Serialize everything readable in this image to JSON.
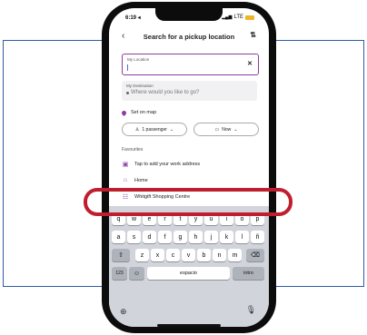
{
  "status_bar": {
    "time": "6:19 ◂",
    "network": "LTE"
  },
  "header": {
    "back_icon": "chevron-left",
    "title": "Search for a pickup location",
    "swap_icon": "swap-arrows"
  },
  "pickup": {
    "label": "My Location",
    "clear_icon": "close"
  },
  "destination": {
    "label": "My Destination",
    "placeholder": "Where would you like to go?"
  },
  "set_on_map": "Set on map",
  "passenger_pill": "1 passenger",
  "time_pill": "Now",
  "favourites": {
    "title": "Favourites",
    "items": [
      {
        "icon": "briefcase",
        "label": "Tap to add your work address"
      },
      {
        "icon": "home",
        "label": "Home"
      },
      {
        "icon": "saved-place",
        "label": "Whitgift Shopping Centre"
      }
    ]
  },
  "keyboard": {
    "row1": [
      "q",
      "w",
      "e",
      "r",
      "t",
      "y",
      "u",
      "i",
      "o",
      "p"
    ],
    "row2": [
      "a",
      "s",
      "d",
      "f",
      "g",
      "h",
      "j",
      "k",
      "l",
      "ñ"
    ],
    "row3": [
      "z",
      "x",
      "c",
      "v",
      "b",
      "n",
      "m"
    ],
    "numbers_key": "123",
    "space_key": "espacio",
    "return_key": "intro"
  },
  "colors": {
    "accent": "#8a3ea0",
    "highlight": "#bf1e2e",
    "frame": "#2e5aa8"
  }
}
